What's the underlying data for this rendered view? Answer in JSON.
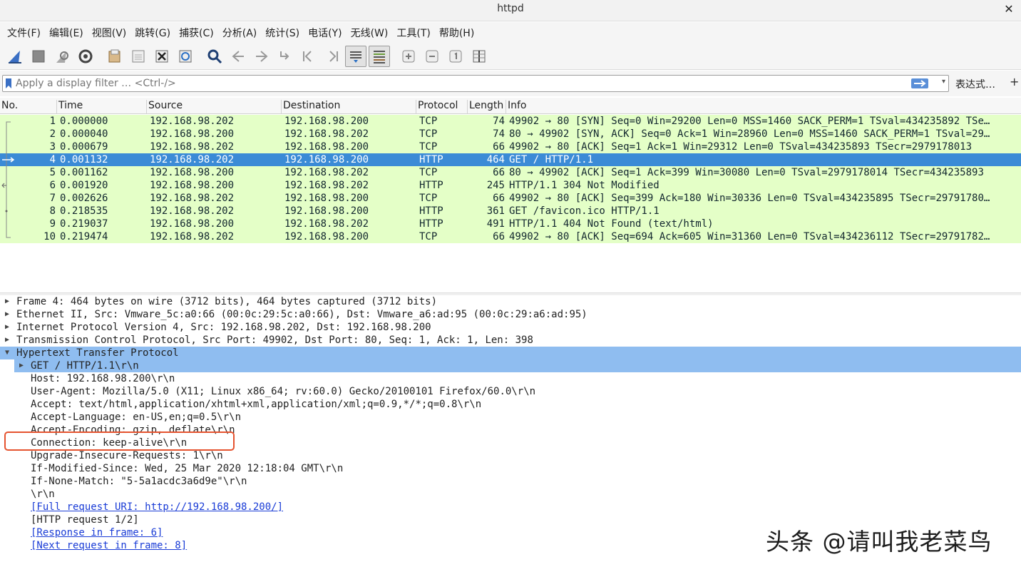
{
  "window": {
    "title": "httpd",
    "close_glyph": "✕"
  },
  "menu": [
    "文件(F)",
    "编辑(E)",
    "视图(V)",
    "跳转(G)",
    "捕获(C)",
    "分析(A)",
    "统计(S)",
    "电话(Y)",
    "无线(W)",
    "工具(T)",
    "帮助(H)"
  ],
  "toolbar": {
    "icons": [
      "shark-fin-start-icon",
      "stop-capture-icon",
      "restart-capture-icon",
      "capture-options-icon",
      "open-file-icon",
      "save-file-icon",
      "close-file-icon",
      "reload-file-icon",
      "find-packet-icon",
      "go-back-icon",
      "go-forward-icon",
      "go-to-packet-icon",
      "first-packet-icon",
      "last-packet-icon",
      "autoscroll-icon",
      "colorize-icon",
      "zoom-in-icon",
      "zoom-out-icon",
      "normal-size-icon",
      "resize-columns-icon"
    ]
  },
  "filter": {
    "placeholder": "Apply a display filter … <Ctrl-/>",
    "value": "",
    "expression_label": "表达式…",
    "add_label": "+",
    "apply_color": "#5a8fd8"
  },
  "packet_list": {
    "columns": [
      "No.",
      "Time",
      "Source",
      "Destination",
      "Protocol",
      "Length",
      "Info"
    ],
    "rows": [
      {
        "no": "1",
        "time": "0.000000",
        "src": "192.168.98.202",
        "dst": "192.168.98.200",
        "proto": "TCP",
        "len": "74",
        "info": "49902 → 80 [SYN] Seq=0 Win=29200 Len=0 MSS=1460 SACK_PERM=1 TSval=434235892 TSe…"
      },
      {
        "no": "2",
        "time": "0.000040",
        "src": "192.168.98.200",
        "dst": "192.168.98.202",
        "proto": "TCP",
        "len": "74",
        "info": "80 → 49902 [SYN, ACK] Seq=0 Ack=1 Win=28960 Len=0 MSS=1460 SACK_PERM=1 TSval=29…"
      },
      {
        "no": "3",
        "time": "0.000679",
        "src": "192.168.98.202",
        "dst": "192.168.98.200",
        "proto": "TCP",
        "len": "66",
        "info": "49902 → 80 [ACK] Seq=1 Ack=1 Win=29312 Len=0 TSval=434235893 TSecr=2979178013"
      },
      {
        "no": "4",
        "time": "0.001132",
        "src": "192.168.98.202",
        "dst": "192.168.98.200",
        "proto": "HTTP",
        "len": "464",
        "info": "GET / HTTP/1.1"
      },
      {
        "no": "5",
        "time": "0.001162",
        "src": "192.168.98.200",
        "dst": "192.168.98.202",
        "proto": "TCP",
        "len": "66",
        "info": "80 → 49902 [ACK] Seq=1 Ack=399 Win=30080 Len=0 TSval=2979178014 TSecr=434235893"
      },
      {
        "no": "6",
        "time": "0.001920",
        "src": "192.168.98.200",
        "dst": "192.168.98.202",
        "proto": "HTTP",
        "len": "245",
        "info": "HTTP/1.1 304 Not Modified"
      },
      {
        "no": "7",
        "time": "0.002626",
        "src": "192.168.98.202",
        "dst": "192.168.98.200",
        "proto": "TCP",
        "len": "66",
        "info": "49902 → 80 [ACK] Seq=399 Ack=180 Win=30336 Len=0 TSval=434235895 TSecr=29791780…"
      },
      {
        "no": "8",
        "time": "0.218535",
        "src": "192.168.98.202",
        "dst": "192.168.98.200",
        "proto": "HTTP",
        "len": "361",
        "info": "GET /favicon.ico HTTP/1.1"
      },
      {
        "no": "9",
        "time": "0.219037",
        "src": "192.168.98.200",
        "dst": "192.168.98.202",
        "proto": "HTTP",
        "len": "491",
        "info": "HTTP/1.1 404 Not Found  (text/html)"
      },
      {
        "no": "10",
        "time": "0.219474",
        "src": "192.168.98.202",
        "dst": "192.168.98.200",
        "proto": "TCP",
        "len": "66",
        "info": "49902 → 80 [ACK] Seq=694 Ack=605 Win=31360 Len=0 TSval=434236112 TSecr=29791782…"
      }
    ],
    "selected_no": "4",
    "row_color": "#e4ffc7",
    "selected_color": "#3b8bd6"
  },
  "details": {
    "lines": [
      {
        "text": "Frame 4: 464 bytes on wire (3712 bits), 464 bytes captured (3712 bits)"
      },
      {
        "text": "Ethernet II, Src: Vmware_5c:a0:66 (00:0c:29:5c:a0:66), Dst: Vmware_a6:ad:95 (00:0c:29:a6:ad:95)"
      },
      {
        "text": "Internet Protocol Version 4, Src: 192.168.98.202, Dst: 192.168.98.200"
      },
      {
        "text": "Transmission Control Protocol, Src Port: 49902, Dst Port: 80, Seq: 1, Ack: 1, Len: 398"
      },
      {
        "text": "Hypertext Transfer Protocol"
      },
      {
        "text": "GET / HTTP/1.1\\r\\n"
      },
      {
        "text": "Host: 192.168.98.200\\r\\n"
      },
      {
        "text": "User-Agent: Mozilla/5.0 (X11; Linux x86_64; rv:60.0) Gecko/20100101 Firefox/60.0\\r\\n"
      },
      {
        "text": "Accept: text/html,application/xhtml+xml,application/xml;q=0.9,*/*;q=0.8\\r\\n"
      },
      {
        "text": "Accept-Language: en-US,en;q=0.5\\r\\n"
      },
      {
        "text": "Accept-Encoding: gzip, deflate\\r\\n"
      },
      {
        "text": "Connection: keep-alive\\r\\n"
      },
      {
        "text": "Upgrade-Insecure-Requests: 1\\r\\n"
      },
      {
        "text": "If-Modified-Since: Wed, 25 Mar 2020 12:18:04 GMT\\r\\n"
      },
      {
        "text": "If-None-Match: \"5-5a1acdc3a6d9e\"\\r\\n"
      },
      {
        "text": "\\r\\n"
      },
      {
        "text": "[Full request URI: http://192.168.98.200/]"
      },
      {
        "text": "[HTTP request 1/2]"
      },
      {
        "text": "[Response in frame: 6]"
      },
      {
        "text": "[Next request in frame: 8]"
      }
    ],
    "highlight_color": "#8fbdf0",
    "annotation_color": "#e5532f"
  },
  "watermark": "头条 @请叫我老菜鸟"
}
